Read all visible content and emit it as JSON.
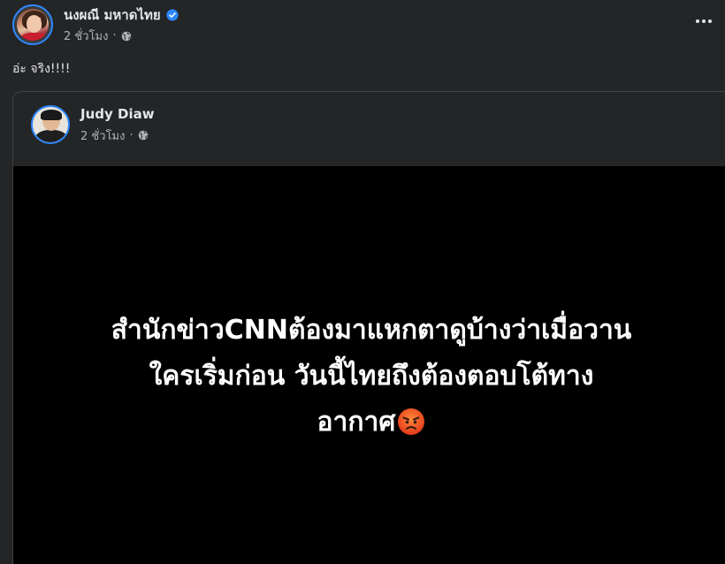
{
  "post": {
    "author_name": "นงผณี มหาดไทย",
    "time": "2 ชั่วโมง",
    "separator": "·",
    "caption": "อ่ะ จริง!!!!"
  },
  "shared_post": {
    "author_name": "Judy Diaw",
    "time": "2 ชั่วโมง",
    "separator": "·",
    "image_text_lines": [
      "สำนักข่าวCNNต้องมาแหกตาดูบ้างว่าเมื่อวาน",
      "ใครเริ่มก่อน วันนี้ไทยถึงต้องตอบโต้ทาง",
      "อากาศ"
    ]
  },
  "icons": {
    "verified": "verified-badge-icon",
    "privacy": "globe-icon",
    "menu": "more-options-icon",
    "emoji": "angry-face-emoji"
  },
  "colors": {
    "background": "#242526",
    "accent": "#2d88ff",
    "text_primary": "#e4e6eb",
    "text_secondary": "#b0b3b8",
    "media_background": "#000000"
  }
}
